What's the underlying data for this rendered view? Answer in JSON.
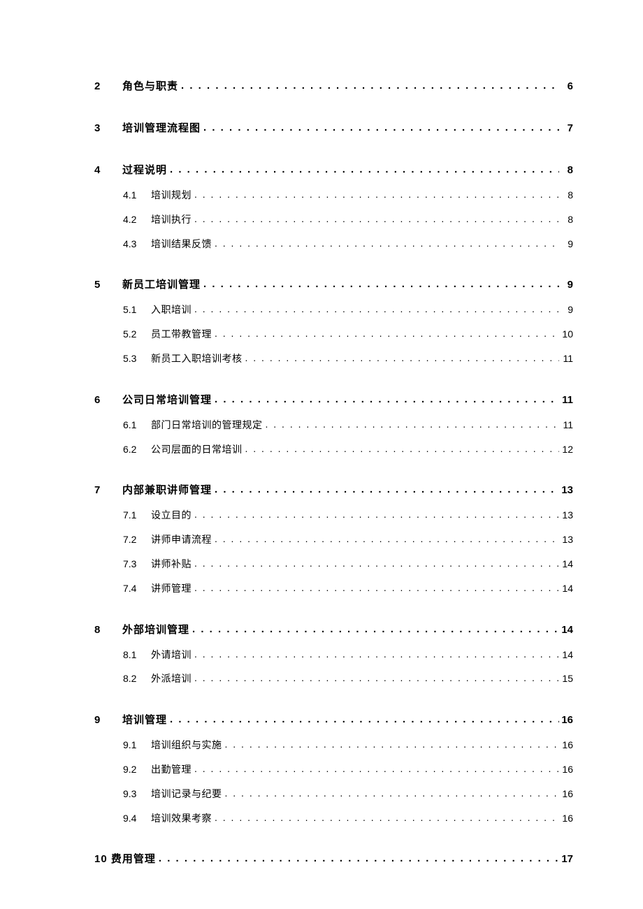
{
  "toc": [
    {
      "num": "2",
      "title": "角色与职责",
      "page": "6",
      "children": []
    },
    {
      "num": "3",
      "title": "培训管理流程图",
      "page": "7",
      "children": []
    },
    {
      "num": "4",
      "title": "过程说明",
      "page": "8",
      "children": [
        {
          "num": "4.1",
          "title": "培训规划",
          "page": "8"
        },
        {
          "num": "4.2",
          "title": "培训执行",
          "page": "8"
        },
        {
          "num": "4.3",
          "title": "培训结果反馈",
          "page": "9"
        }
      ]
    },
    {
      "num": "5",
      "title": "新员工培训管理",
      "page": "9",
      "children": [
        {
          "num": "5.1",
          "title": "入职培训",
          "page": "9"
        },
        {
          "num": "5.2",
          "title": "员工带教管理",
          "page": "10"
        },
        {
          "num": "5.3",
          "title": "新员工入职培训考核",
          "page": "11"
        }
      ]
    },
    {
      "num": "6",
      "title": "公司日常培训管理",
      "page": "11",
      "children": [
        {
          "num": "6.1",
          "title": "部门日常培训的管理规定",
          "page": "11"
        },
        {
          "num": "6.2",
          "title": "公司层面的日常培训",
          "page": "12"
        }
      ]
    },
    {
      "num": "7",
      "title": "内部兼职讲师管理",
      "page": "13",
      "children": [
        {
          "num": "7.1",
          "title": "设立目的",
          "page": "13"
        },
        {
          "num": "7.2",
          "title": "讲师申请流程",
          "page": "13"
        },
        {
          "num": "7.3",
          "title": "讲师补贴",
          "page": "14"
        },
        {
          "num": "7.4",
          "title": "讲师管理",
          "page": "14"
        }
      ]
    },
    {
      "num": "8",
      "title": "外部培训管理",
      "page": "14",
      "children": [
        {
          "num": "8.1",
          "title": "外请培训",
          "page": "14"
        },
        {
          "num": "8.2",
          "title": "外派培训",
          "page": "15"
        }
      ]
    },
    {
      "num": "9",
      "title": "培训管理",
      "page": "16",
      "children": [
        {
          "num": "9.1",
          "title": "培训组织与实施",
          "page": "16"
        },
        {
          "num": "9.2",
          "title": "出勤管理",
          "page": "16"
        },
        {
          "num": "9.3",
          "title": "培训记录与纪要",
          "page": "16"
        },
        {
          "num": "9.4",
          "title": "培训效果考察",
          "page": "16"
        }
      ]
    },
    {
      "num": "10",
      "title": "费用管理",
      "page": "17",
      "children": [],
      "nonum_gap": true
    }
  ]
}
